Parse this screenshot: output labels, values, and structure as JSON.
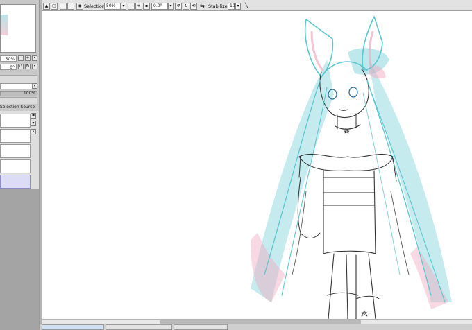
{
  "navigator": {
    "zoom": "50%",
    "rotation": "0°"
  },
  "layer_panel": {
    "opacity": "100%",
    "selection_source_label": "Selection Source"
  },
  "toolbar": {
    "selection_label": "Selection",
    "zoom_value": "50%",
    "rotation_value": "0.0°",
    "stabilizer_label": "Stabilizer",
    "stabilizer_value": "10"
  },
  "tabs": [
    {
      "name": "",
      "zoom": ""
    },
    {
      "name": "",
      "zoom": ""
    },
    {
      "name": "",
      "zoom": ""
    }
  ],
  "colors": {
    "hair_cyan": "#5cc6d0",
    "hair_pink": "#f0a9bf",
    "selected_layer": "#dcdcf6"
  },
  "icons": [
    "scroll-up-icon",
    "fit-icon",
    "zoom-out-icon",
    "zoom-in-icon",
    "rotate-ccw-icon",
    "rotate-cw-icon",
    "reset-icon",
    "flip-icon",
    "stabilizer-icon",
    "line-tool-icon"
  ]
}
